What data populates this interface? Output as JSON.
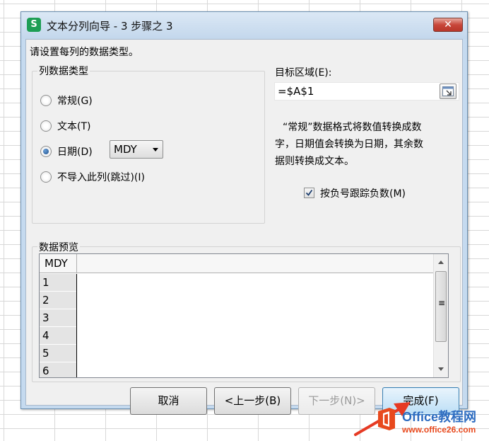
{
  "window": {
    "app_icon_letter": "S",
    "title": "文本分列向导 - 3 步骤之 3",
    "close_glyph": "✕"
  },
  "instruction": "请设置每列的数据类型。",
  "column_type_group": {
    "legend": "列数据类型",
    "options": [
      {
        "label": "常规(G)",
        "checked": false
      },
      {
        "label": "文本(T)",
        "checked": false
      },
      {
        "label": "日期(D)",
        "checked": true
      },
      {
        "label": "不导入此列(跳过)(I)",
        "checked": false
      }
    ],
    "date_format_value": "MDY"
  },
  "destination": {
    "label": "目标区域(E):",
    "value": "=$A$1"
  },
  "description_lines": [
    "“常规”数据格式将数值转换成数",
    "字，日期值会转换为日期，其余数",
    "据则转换成文本。"
  ],
  "negative_sign_option": {
    "label": "按负号跟踪负数(M)",
    "checked": true,
    "check_glyph": "✓"
  },
  "preview": {
    "legend": "数据预览",
    "column_header": "MDY",
    "row_numbers": [
      "1",
      "2",
      "3",
      "4",
      "5",
      "6"
    ],
    "scroll_grip_glyph": "≡"
  },
  "buttons": {
    "cancel": "取消",
    "back": "<上一步(B)",
    "next": "下一步(N)>",
    "finish": "完成(F)"
  },
  "watermark": {
    "title": "Office教程网",
    "url": "www.office26.com"
  },
  "colors": {
    "title_bar": "#c5daef",
    "close_button": "#c8473a",
    "finish_button": "#bcdff6",
    "watermark_blue": "#2d6cc0",
    "watermark_orange": "#e8491d"
  }
}
